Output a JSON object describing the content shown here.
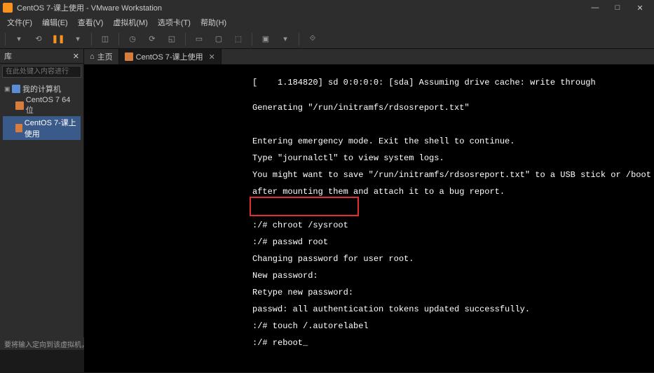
{
  "titlebar": {
    "title": "CentOS 7-课上使用 - VMware Workstation"
  },
  "menubar": {
    "file": "文件(F)",
    "edit": "编辑(E)",
    "view": "查看(V)",
    "vm": "虚拟机(M)",
    "tabs": "选项卡(T)",
    "help": "帮助(H)"
  },
  "sidebar": {
    "header": "库",
    "search_placeholder": "在此处键入内容进行搜索",
    "root": "我的计算机",
    "items": [
      {
        "label": "CentOS 7 64 位"
      },
      {
        "label": "CentOS 7-课上使用"
      }
    ]
  },
  "tabs": {
    "home": "主页",
    "vm": "CentOS 7-课上使用"
  },
  "terminal": {
    "l0": "[    1.184820] sd 0:0:0:0: [sda] Assuming drive cache: write through",
    "l1": "",
    "l2": "Generating \"/run/initramfs/rdsosreport.txt\"",
    "l3": "",
    "l4": "",
    "l5": "Entering emergency mode. Exit the shell to continue.",
    "l6": "Type \"journalctl\" to view system logs.",
    "l7": "You might want to save \"/run/initramfs/rdsosreport.txt\" to a USB stick or /boot",
    "l8": "after mounting them and attach it to a bug report.",
    "l9": "",
    "l10": "",
    "l11": ":/# chroot /sysroot",
    "l12": ":/# passwd root",
    "l13": "Changing password for user root.",
    "l14": "New password:",
    "l15": "Retype new password:",
    "l16": "passwd: all authentication tokens updated successfully.",
    "l17": ":/# touch /.autorelabel",
    "l18": ":/# reboot_"
  },
  "statusbar": {
    "text": "要将输入定向到该虚拟机，请在虚拟机内部单击或按 Ctrl+G。"
  }
}
